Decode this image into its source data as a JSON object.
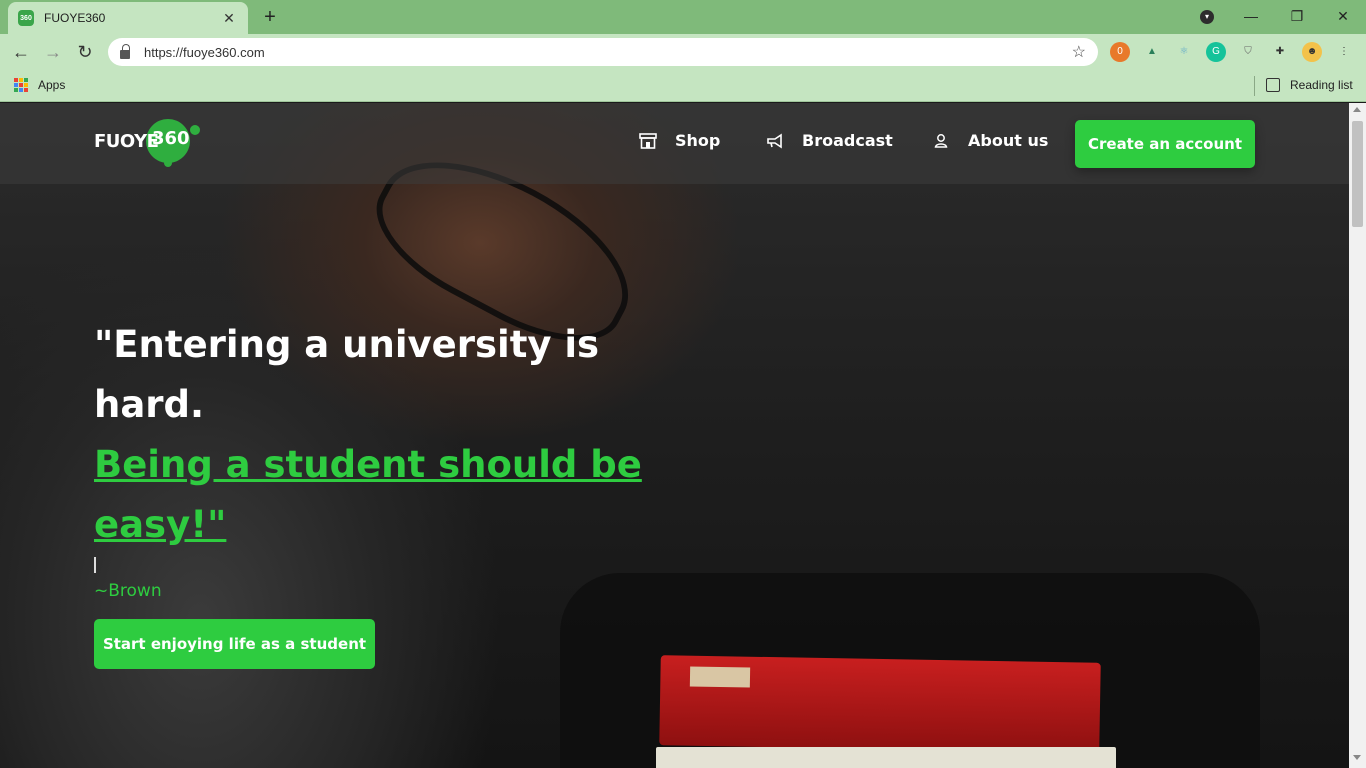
{
  "browser": {
    "tab_title": "FUOYE360",
    "tab_favicon": "360",
    "new_tab_icon": "+",
    "url": "https://fuoye360.com",
    "bookmarks": {
      "apps_label": "Apps",
      "reading_list_label": "Reading list"
    },
    "extension_badge": "0"
  },
  "site": {
    "logo_text": "FUOYE",
    "logo_number": "360",
    "nav": [
      {
        "label": "Shop",
        "icon": "store-icon"
      },
      {
        "label": "Broadcast",
        "icon": "megaphone-icon"
      },
      {
        "label": "About us",
        "icon": "user-icon"
      }
    ],
    "cta_label": "Create an account",
    "hero": {
      "quote_line1": "\"Entering a university is hard.",
      "quote_line2": "Being a student should be easy!\"",
      "author": "~Brown",
      "button_label": "Start enjoying life as a student"
    }
  },
  "colors": {
    "accent": "#2ecc40",
    "chrome_tabstrip": "#7fba7a",
    "chrome_toolbar": "#c5e5c1"
  }
}
